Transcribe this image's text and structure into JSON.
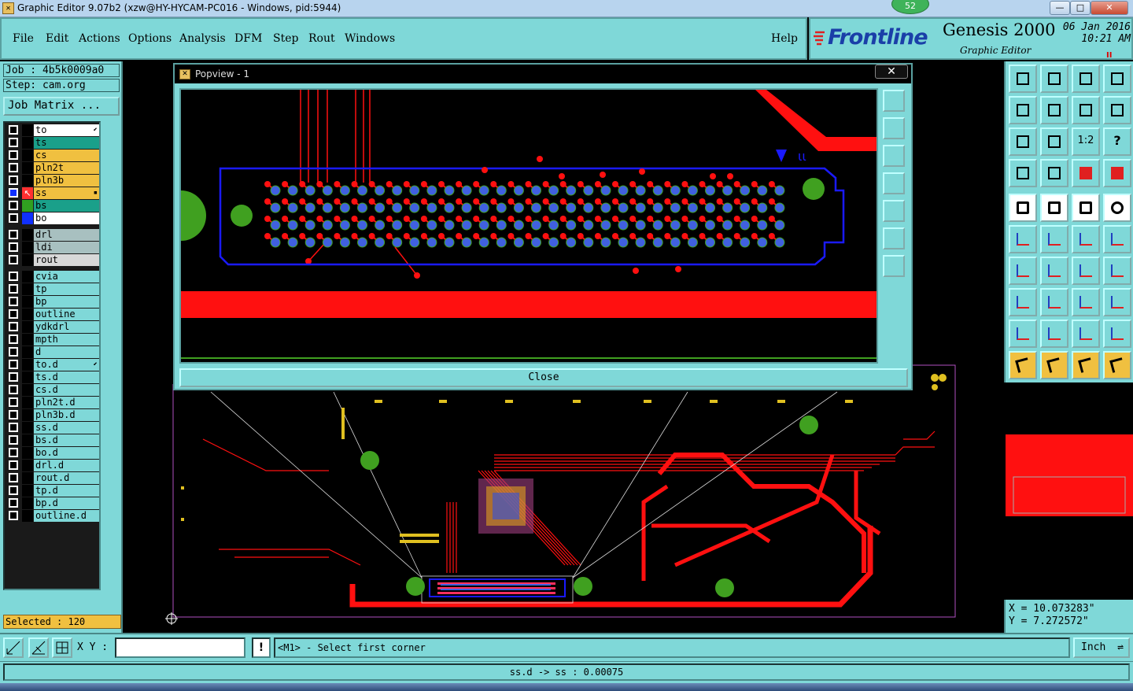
{
  "window": {
    "title": "Graphic Editor 9.07b2 (xzw@HY-HYCAM-PC016 - Windows, pid:5944)",
    "notification_count": "52",
    "controls": {
      "minimize": "—",
      "maximize": "□",
      "close": "✕"
    }
  },
  "menu": {
    "items": [
      "File",
      "Edit",
      "Actions",
      "Options",
      "Analysis",
      "DFM",
      "Step",
      "Rout",
      "Windows"
    ],
    "help": "Help"
  },
  "brand": {
    "logo": "Frontline",
    "product": "Genesis 2000",
    "subtitle": "Graphic Editor",
    "date": "06 Jan 2016",
    "time": "10:21 AM",
    "pause_glyph": "II"
  },
  "job": {
    "job_label": "Job : 4b5k0009a0",
    "step_label": "Step: cam.org",
    "matrix_button": "Job Matrix ..."
  },
  "layers": [
    {
      "name": "to",
      "color": "#ffffff",
      "swatch": "#000000",
      "flag": "⬋"
    },
    {
      "name": "ts",
      "color": "#1aa08a",
      "swatch": "#000000"
    },
    {
      "name": "cs",
      "color": "#f0c040",
      "swatch": "#000000"
    },
    {
      "name": "pln2t",
      "color": "#f0c040",
      "swatch": "#000000"
    },
    {
      "name": "pln3b",
      "color": "#f0c040",
      "swatch": "#000000"
    },
    {
      "name": "ss",
      "color": "#f0c040",
      "swatch": "#ff3030",
      "flag": "▪",
      "active": true
    },
    {
      "name": "bs",
      "color": "#1aa08a",
      "swatch": "#30a020"
    },
    {
      "name": "bo",
      "color": "#ffffff",
      "swatch": "#1030ff"
    },
    {
      "name": "drl",
      "color": "#a8c0c0",
      "swatch": "#000000"
    },
    {
      "name": "ldi",
      "color": "#a8c0c0",
      "swatch": "#000000"
    },
    {
      "name": "rout",
      "color": "#d8d8d8",
      "swatch": "#000000"
    },
    {
      "name": "cvia",
      "color": "#7fd8d8",
      "swatch": "#000000"
    },
    {
      "name": "tp",
      "color": "#7fd8d8",
      "swatch": "#000000"
    },
    {
      "name": "bp",
      "color": "#7fd8d8",
      "swatch": "#000000"
    },
    {
      "name": "outline",
      "color": "#7fd8d8",
      "swatch": "#000000"
    },
    {
      "name": "ydkdrl",
      "color": "#7fd8d8",
      "swatch": "#000000"
    },
    {
      "name": "mpth",
      "color": "#7fd8d8",
      "swatch": "#000000"
    },
    {
      "name": "d",
      "color": "#7fd8d8",
      "swatch": "#000000"
    },
    {
      "name": "to.d",
      "color": "#7fd8d8",
      "swatch": "#000000",
      "flag": "⬋"
    },
    {
      "name": "ts.d",
      "color": "#7fd8d8",
      "swatch": "#000000"
    },
    {
      "name": "cs.d",
      "color": "#7fd8d8",
      "swatch": "#000000"
    },
    {
      "name": "pln2t.d",
      "color": "#7fd8d8",
      "swatch": "#000000"
    },
    {
      "name": "pln3b.d",
      "color": "#7fd8d8",
      "swatch": "#000000"
    },
    {
      "name": "ss.d",
      "color": "#7fd8d8",
      "swatch": "#000000"
    },
    {
      "name": "bs.d",
      "color": "#7fd8d8",
      "swatch": "#000000"
    },
    {
      "name": "bo.d",
      "color": "#7fd8d8",
      "swatch": "#000000"
    },
    {
      "name": "drl.d",
      "color": "#7fd8d8",
      "swatch": "#000000"
    },
    {
      "name": "rout.d",
      "color": "#7fd8d8",
      "swatch": "#000000"
    },
    {
      "name": "tp.d",
      "color": "#7fd8d8",
      "swatch": "#000000"
    },
    {
      "name": "bp.d",
      "color": "#7fd8d8",
      "swatch": "#000000"
    },
    {
      "name": "outline.d",
      "color": "#7fd8d8",
      "swatch": "#000000"
    }
  ],
  "selected": "Selected : 120",
  "popview": {
    "title": "Popview - 1",
    "close_x": "✕",
    "close_button": "Close",
    "tools": [
      "zoom-window-icon",
      "pan-up-icon",
      "pan-down-icon",
      "pan-left-icon",
      "pan-right-icon",
      "zoom-in-icon",
      "zoom-out-icon"
    ]
  },
  "toolbox": {
    "icon_text": {
      "one_to_two": "1:2",
      "help": "?"
    }
  },
  "coords": {
    "x": "X = 10.073283\"",
    "y": "Y = 7.272572\""
  },
  "bottom": {
    "xy_label": "X Y :",
    "xy_value": "",
    "exclamation": "!",
    "prompt": "<M1> - Select first corner",
    "unit": "Inch"
  },
  "status": "ss.d -> ss : 0.00075",
  "colors": {
    "panel": "#7fd8d8",
    "trace_red": "#ff1010",
    "pad_blue": "#4060e0",
    "pad_green": "#40a020",
    "outline_blue": "#1a1aff"
  }
}
